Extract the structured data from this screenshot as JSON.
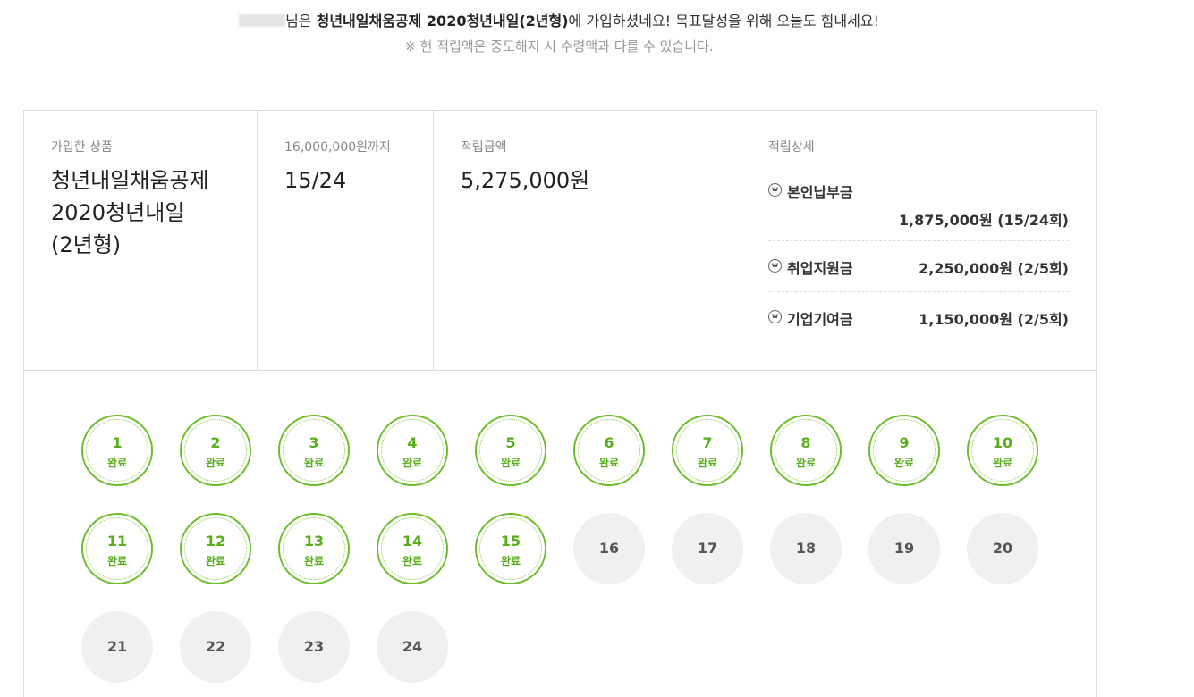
{
  "notice": {
    "suffix_pre": "님은 ",
    "product_bold": "청년내일채움공제 2020청년내일(2년형)",
    "suffix_post": "에 가입하셨네요! 목표달성을 위해 오늘도 힘내세요!",
    "disclaimer": "※ 현 적립액은 중도해지 시 수령액과 다를 수 있습니다."
  },
  "summary": {
    "product": {
      "label": "가입한 상품",
      "lines": [
        "청년내일채움공제",
        "2020청년내일",
        "(2년형)"
      ]
    },
    "progress": {
      "label": "16,000,000원까지",
      "value": "15/24"
    },
    "amount": {
      "label": "적립금액",
      "value": "5,275,000원"
    },
    "detail": {
      "label": "적립상세",
      "icon": "won-coin-icon",
      "items": [
        {
          "name": "본인납부금",
          "amount": "1,875,000원 (15/24회)"
        },
        {
          "name": "취업지원금",
          "amount": "2,250,000원 (2/5회)"
        },
        {
          "name": "기업기여금",
          "amount": "1,150,000원 (2/5회)"
        }
      ]
    }
  },
  "installments": {
    "done_label": "완료",
    "accent_color": "#6bbd2a",
    "items": [
      {
        "num": "1",
        "done": true
      },
      {
        "num": "2",
        "done": true
      },
      {
        "num": "3",
        "done": true
      },
      {
        "num": "4",
        "done": true
      },
      {
        "num": "5",
        "done": true
      },
      {
        "num": "6",
        "done": true
      },
      {
        "num": "7",
        "done": true
      },
      {
        "num": "8",
        "done": true
      },
      {
        "num": "9",
        "done": true
      },
      {
        "num": "10",
        "done": true
      },
      {
        "num": "11",
        "done": true
      },
      {
        "num": "12",
        "done": true
      },
      {
        "num": "13",
        "done": true
      },
      {
        "num": "14",
        "done": true
      },
      {
        "num": "15",
        "done": true
      },
      {
        "num": "16",
        "done": false
      },
      {
        "num": "17",
        "done": false
      },
      {
        "num": "18",
        "done": false
      },
      {
        "num": "19",
        "done": false
      },
      {
        "num": "20",
        "done": false
      },
      {
        "num": "21",
        "done": false
      },
      {
        "num": "22",
        "done": false
      },
      {
        "num": "23",
        "done": false
      },
      {
        "num": "24",
        "done": false
      }
    ]
  }
}
